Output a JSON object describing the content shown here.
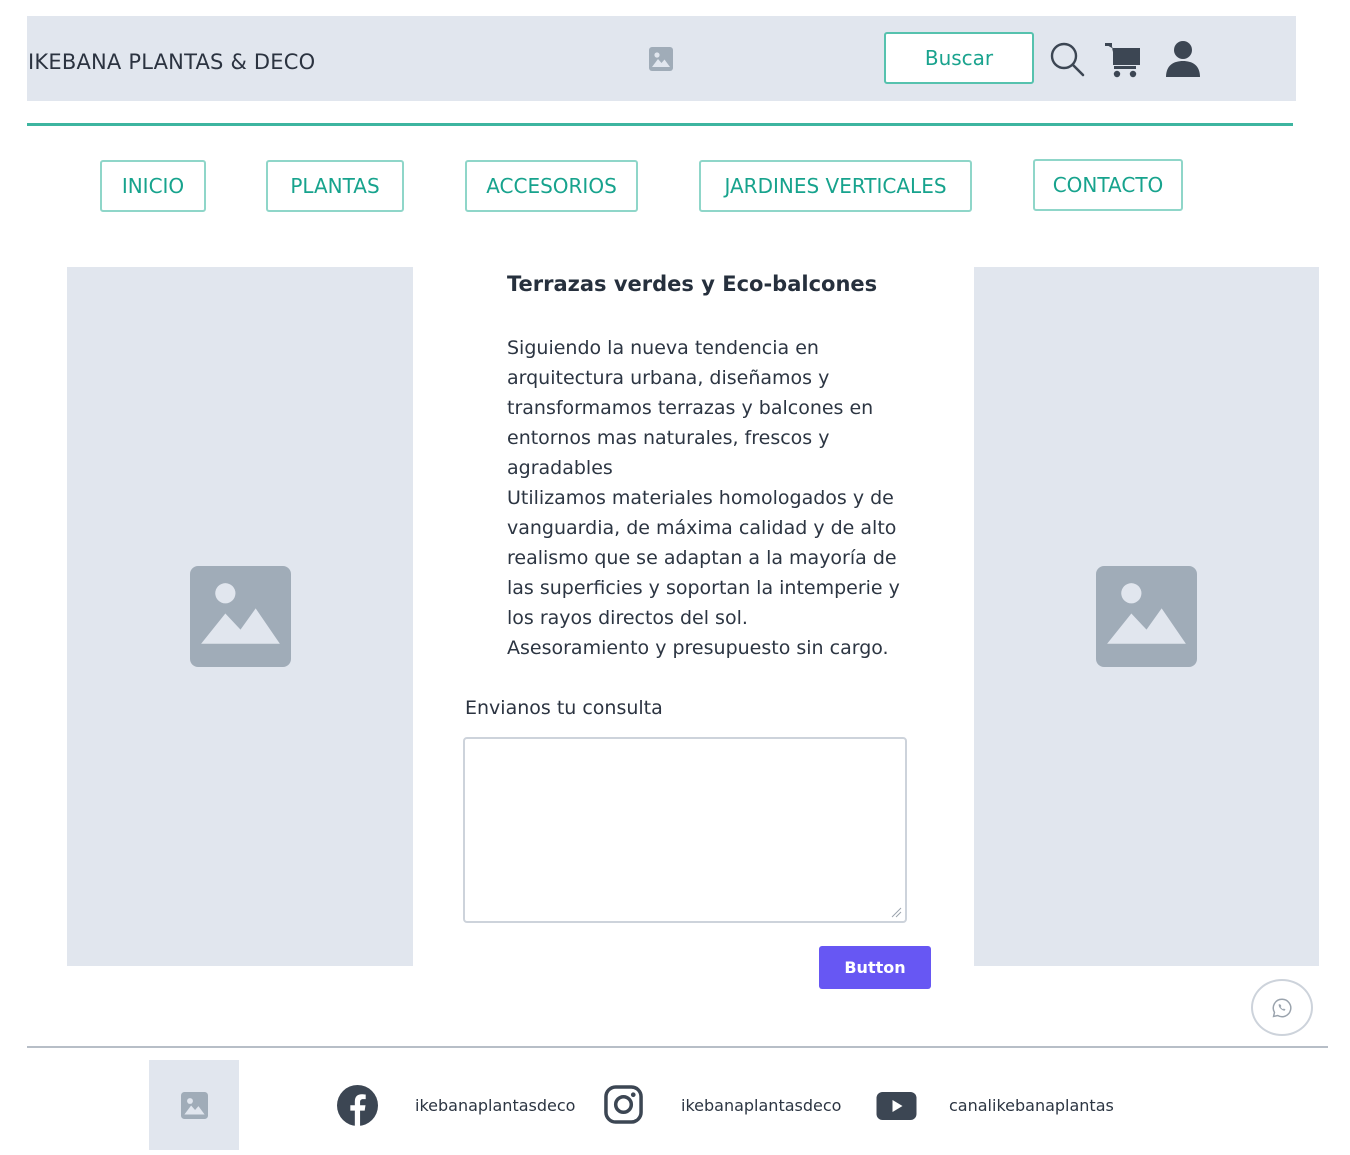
{
  "header": {
    "brand": "IKEBANA PLANTAS & DECO",
    "search_label": "Buscar",
    "icons": [
      "image-placeholder-icon",
      "search-icon",
      "cart-icon",
      "user-icon"
    ]
  },
  "nav": {
    "items": [
      "INICIO",
      "PLANTAS",
      "ACCESORIOS",
      "JARDINES VERTICALES",
      "CONTACTO"
    ]
  },
  "content": {
    "title": "Terrazas verdes y Eco-balcones",
    "paragraph1": "Siguiendo la nueva tendencia en arquitectura urbana, diseñamos y transformamos terrazas y balcones en entornos mas naturales, frescos y agradables",
    "paragraph2": "Utilizamos materiales homologados y de vanguardia, de máxima calidad y de alto realismo que se adaptan a la mayoría de las superficies y soportan la intemperie y los rayos directos del sol.",
    "paragraph3": "Asesoramiento y presupuesto sin cargo."
  },
  "form": {
    "label": "Envianos tu consulta",
    "textarea_value": "",
    "submit_label": "Button"
  },
  "footer": {
    "facebook": "ikebanaplantasdeco",
    "instagram": "ikebanaplantasdeco",
    "youtube": "canalikebanaplantas"
  },
  "colors": {
    "accent": "#3db5a0",
    "accent_text": "#17a38d",
    "panel": "#e1e6ee",
    "placeholder_icon": "#a0acb8",
    "button": "#6757f3",
    "dark_icon": "#3c4653"
  }
}
